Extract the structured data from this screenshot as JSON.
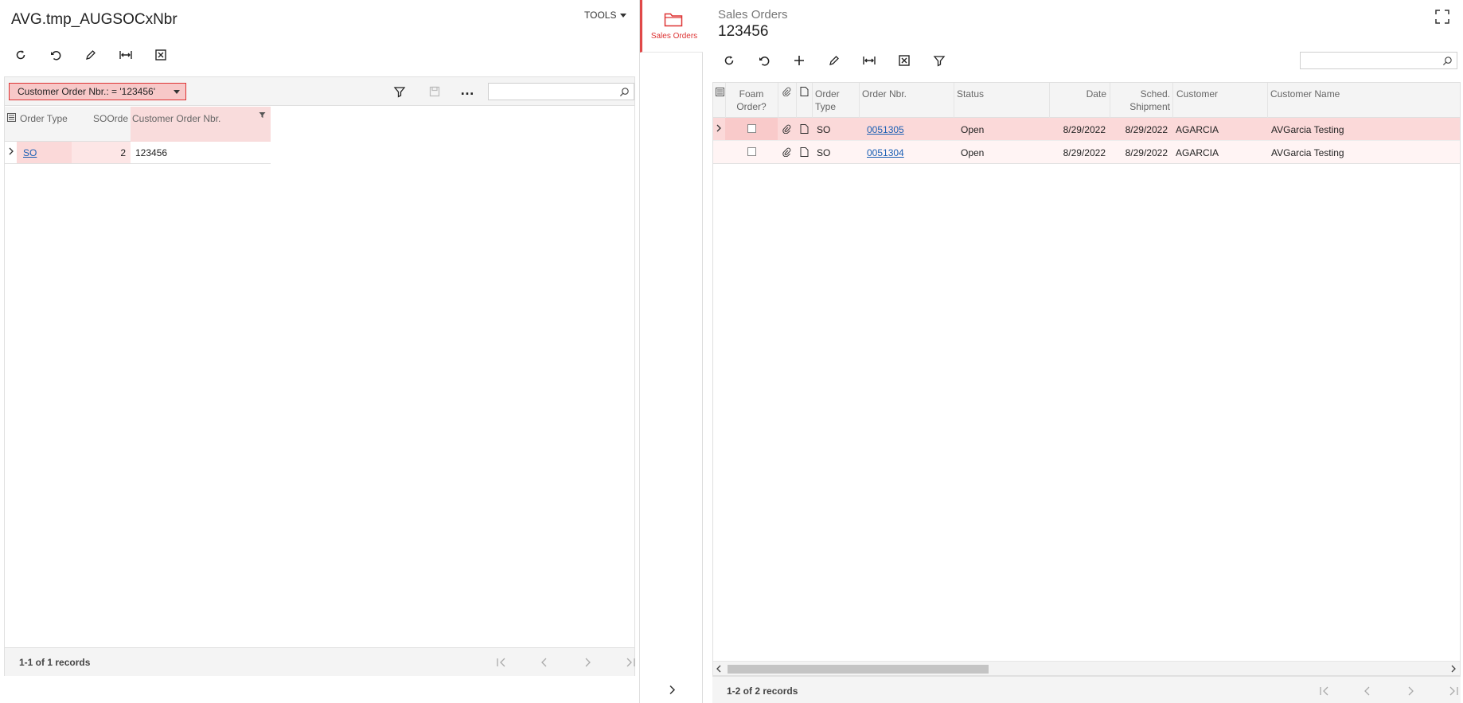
{
  "left": {
    "title": "AVG.tmp_AUGSOCxNbr",
    "tools_label": "TOOLS",
    "filter_chip": "Customer Order Nbr.: = '123456'",
    "grid": {
      "columns": [
        "Order Type",
        "SOOrde",
        "Customer Order Nbr."
      ],
      "rows": [
        {
          "order_type": "SO",
          "soorder": "2",
          "customer_order_nbr": "123456"
        }
      ]
    },
    "footer": {
      "records": "1-1 of 1 records"
    }
  },
  "middle": {
    "tab_label": "Sales Orders"
  },
  "right": {
    "subtitle": "Sales Orders",
    "title": "123456",
    "grid": {
      "columns": {
        "foam": "Foam Order?",
        "order_type": "Order Type",
        "order_nbr": "Order Nbr.",
        "status": "Status",
        "date": "Date",
        "sched": "Sched. Shipment",
        "customer": "Customer",
        "customer_name": "Customer Name"
      },
      "rows": [
        {
          "order_type": "SO",
          "order_nbr": "0051305",
          "status": "Open",
          "date": "8/29/2022",
          "sched": "8/29/2022",
          "customer": "AGARCIA",
          "customer_name": "AVGarcia Testing"
        },
        {
          "order_type": "SO",
          "order_nbr": "0051304",
          "status": "Open",
          "date": "8/29/2022",
          "sched": "8/29/2022",
          "customer": "AGARCIA",
          "customer_name": "AVGarcia Testing"
        }
      ]
    },
    "footer": {
      "records": "1-2 of 2 records"
    }
  },
  "colors": {
    "accent": "#e04848",
    "selected_row": "#fbd9d9",
    "link": "#1a5fb4"
  }
}
